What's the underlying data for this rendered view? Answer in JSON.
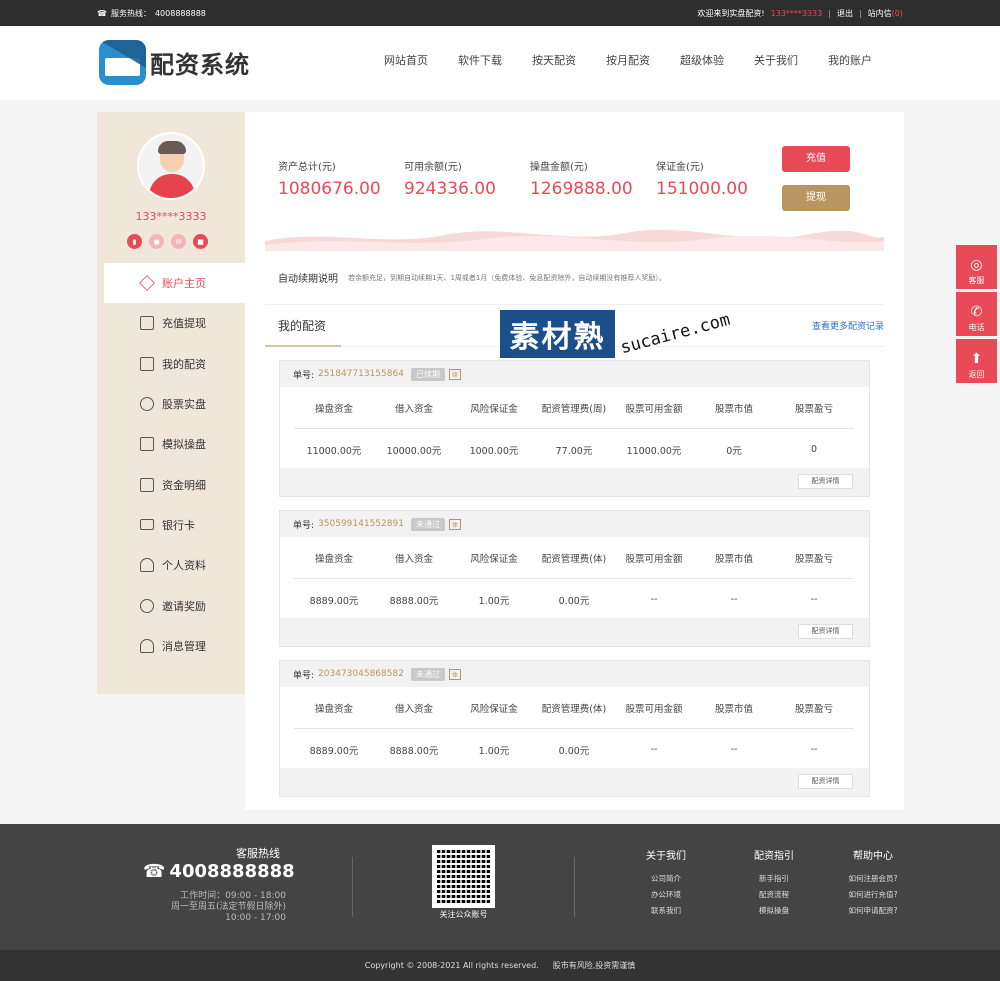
{
  "topbar": {
    "hotline_label": "服务热线：",
    "hotline": "4008888888",
    "welcome": "欢迎来到实盘配资!",
    "user": "133****3333",
    "logout": "退出",
    "inbox": "站内信",
    "inbox_count": "(0)"
  },
  "header": {
    "logo_text": "配资系统",
    "nav": [
      "网站首页",
      "软件下载",
      "按天配资",
      "按月配资",
      "超级体验",
      "关于我们",
      "我的账户"
    ]
  },
  "sidebar": {
    "username": "133****3333",
    "menu": [
      "账户主页",
      "充值提现",
      "我的配资",
      "股票实盘",
      "模拟操盘",
      "资金明细",
      "银行卡",
      "个人资料",
      "邀请奖励",
      "消息管理"
    ]
  },
  "stats": [
    {
      "label": "资产总计(元)",
      "value": "1080676.00"
    },
    {
      "label": "可用余额(元)",
      "value": "924336.00"
    },
    {
      "label": "操盘金额(元)",
      "value": "1269888.00"
    },
    {
      "label": "保证金(元)",
      "value": "151000.00"
    }
  ],
  "buttons": {
    "charge": "充值",
    "withdraw": "提现"
  },
  "renew": {
    "title": "自动续期说明",
    "desc": "若余额充足，到期自动续期1天、1周或者1月（免费体验、免息配资除外，自动续期没有推荐人奖励）。"
  },
  "my_tab": {
    "title": "我的配资",
    "more": "查看更多配资记录"
  },
  "watermark": {
    "cn": "素材熟",
    "site": "sucaire.com"
  },
  "orders": [
    {
      "label": "单号:",
      "no": "251847713155864",
      "status": "已续期",
      "tag": "续",
      "headers": [
        "操盘资金",
        "借入资金",
        "风险保证金",
        "配资管理费(周)",
        "股票可用金额",
        "股票市值",
        "股票盈亏"
      ],
      "values": [
        "11000.00元",
        "10000.00元",
        "1000.00元",
        "77.00元",
        "11000.00元",
        "0元",
        "0"
      ],
      "detail": "配资详情"
    },
    {
      "label": "单号:",
      "no": "350599141552891",
      "status": "未通过",
      "tag": "体",
      "headers": [
        "操盘资金",
        "借入资金",
        "风险保证金",
        "配资管理费(体)",
        "股票可用金额",
        "股票市值",
        "股票盈亏"
      ],
      "values": [
        "8889.00元",
        "8888.00元",
        "1.00元",
        "0.00元",
        "--",
        "--",
        "--"
      ],
      "detail": "配资详情"
    },
    {
      "label": "单号:",
      "no": "203473045868582",
      "status": "未通过",
      "tag": "体",
      "headers": [
        "操盘资金",
        "借入资金",
        "风险保证金",
        "配资管理费(体)",
        "股票可用金额",
        "股票市值",
        "股票盈亏"
      ],
      "values": [
        "8889.00元",
        "8888.00元",
        "1.00元",
        "0.00元",
        "--",
        "--",
        "--"
      ],
      "detail": "配资详情"
    }
  ],
  "float": [
    {
      "label": "客服",
      "icon": "headset-icon"
    },
    {
      "label": "电话",
      "icon": "phone-icon"
    },
    {
      "label": "返回",
      "icon": "arrow-up-icon"
    }
  ],
  "footer": {
    "hot_title": "客服热线",
    "hot_num": "4008888888",
    "hours1": "工作时间：09:00 - 18:00",
    "hours2": "周一至周五(法定节假日除外)",
    "hours3": "10:00 - 17:00",
    "qr_caption": "关注公众账号",
    "cols": [
      {
        "title": "关于我们",
        "links": [
          "公司简介",
          "办公环境",
          "联系我们"
        ]
      },
      {
        "title": "配资指引",
        "links": [
          "新手指引",
          "配资流程",
          "模拟操盘"
        ]
      },
      {
        "title": "帮助中心",
        "links": [
          "如何注册会员?",
          "如何进行充值?",
          "如何申请配资?"
        ]
      }
    ],
    "copyright": "Copyright © 2008-2021 All rights reserved.",
    "risk": "股市有风险,投资需谨慎"
  },
  "colors": {
    "accent": "#e84a57",
    "gold": "#b99661",
    "sidebar_bg": "#f1e6da",
    "link": "#2b72c8"
  }
}
